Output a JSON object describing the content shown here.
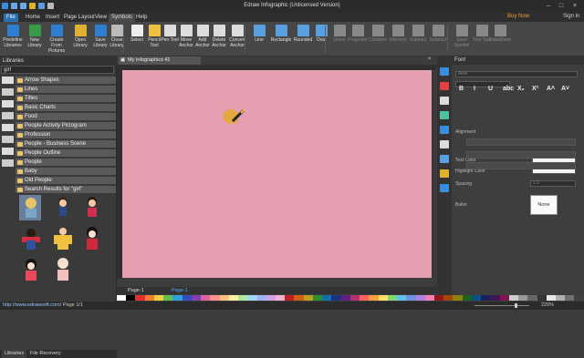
{
  "app": {
    "title": "Edraw Infographic (Unlicensed Version)",
    "buy_now": "Buy Now",
    "sign_in": "Sign in"
  },
  "menu": [
    "File",
    "Home",
    "Insert",
    "Page Layout",
    "View",
    "Symbols",
    "Help"
  ],
  "ribbon": [
    {
      "label": "Predefine Libraries",
      "icon": "library-icon",
      "color": "#2f7fd0"
    },
    {
      "label": "New Library",
      "icon": "new-library-icon",
      "color": "#3a9a4a"
    },
    {
      "label": "Create From Pictures",
      "icon": "picture-icon",
      "color": "#2f7fd0"
    },
    {
      "label": "Open Library",
      "icon": "folder-icon",
      "color": "#e0b030"
    },
    {
      "label": "Save Library",
      "icon": "save-icon",
      "color": "#2f7fd0"
    },
    {
      "label": "Close Library",
      "icon": "close-library-icon",
      "color": "#bbbbbb"
    },
    {
      "label": "Select",
      "icon": "cursor-icon",
      "color": "#eeeeee"
    },
    {
      "label": "Pencil Tool",
      "icon": "pencil-icon",
      "color": "#f0c040"
    },
    {
      "label": "Pen Tool",
      "icon": "pen-icon",
      "color": "#dddddd"
    },
    {
      "label": "Move Anchor",
      "icon": "move-anchor-icon",
      "color": "#dddddd"
    },
    {
      "label": "Add Anchor",
      "icon": "add-anchor-icon",
      "color": "#dddddd"
    },
    {
      "label": "Delete Anchor",
      "icon": "delete-anchor-icon",
      "color": "#dddddd"
    },
    {
      "label": "Convert Anchor",
      "icon": "convert-anchor-icon",
      "color": "#dddddd"
    },
    {
      "label": "Line",
      "icon": "line-icon",
      "color": "#5aa0e0"
    },
    {
      "label": "Rectangle",
      "icon": "rectangle-icon",
      "color": "#5aa0e0"
    },
    {
      "label": "Rounded",
      "icon": "rounded-rect-icon",
      "color": "#5aa0e0"
    },
    {
      "label": "Oval",
      "icon": "oval-icon",
      "color": "#5aa0e0"
    },
    {
      "label": "Union",
      "icon": "union-icon",
      "color": "#888888"
    },
    {
      "label": "Fragment",
      "icon": "fragment-icon",
      "color": "#888888"
    },
    {
      "label": "Combine",
      "icon": "combine-icon",
      "color": "#888888"
    },
    {
      "label": "Intersect",
      "icon": "intersect-icon",
      "color": "#888888"
    },
    {
      "label": "Subtract",
      "icon": "subtract-icon",
      "color": "#888888"
    },
    {
      "label": "Subtract",
      "icon": "subtract-icon",
      "color": "#888888"
    },
    {
      "label": "Save Symbol",
      "icon": "save-symbol-icon",
      "color": "#888888"
    },
    {
      "label": "Text Tool",
      "icon": "text-tool-icon",
      "color": "#888888"
    },
    {
      "label": "DataSheet",
      "icon": "datasheet-icon",
      "color": "#888888"
    }
  ],
  "libraries": {
    "header": "Libraries",
    "search_value": "girl",
    "items": [
      "Arrow Shapes",
      "Lines",
      "Titles",
      "Basic Charts",
      "Food",
      "People Activity Pictogram",
      "Profession",
      "People - Business Scene",
      "People Outline",
      "People",
      "Baby",
      "Old People",
      "Search Results for \"girl\""
    ],
    "tabs": [
      "Libraries",
      "File Recovery"
    ]
  },
  "document": {
    "tab_label": "My Infographics 41",
    "page_label": "Page-1",
    "page_label_active": "Page-1",
    "canvas_color": "#e49fb0"
  },
  "status": {
    "url": "http://www.edrawsoft.com/",
    "page_info": "Page 1/1",
    "zoom": "220%"
  },
  "font_panel": {
    "header": "Font",
    "font_name": "Arial",
    "format_buttons": [
      "B",
      "I",
      "U",
      "abc",
      "X₂",
      "X²",
      "A˄",
      "A˅"
    ],
    "text_color_label": "Text Color",
    "highlight_label": "Highlight Color",
    "alignment_label": "Alignment",
    "spacing_label": "Spacing",
    "spacing_value": "1.0",
    "bullet_label": "Bullet",
    "bullet_value": "None"
  },
  "palette": [
    "#ffffff",
    "#000000",
    "#e03030",
    "#f08030",
    "#f0d040",
    "#60c050",
    "#30a0e0",
    "#3050c0",
    "#8040b0",
    "#e060a0",
    "#ff9090",
    "#ffc080",
    "#fff0a0",
    "#b0e8a0",
    "#a0d8f8",
    "#a0b0f0",
    "#d0a0e8",
    "#f8b0d0",
    "#c02020",
    "#d06010",
    "#c0a020",
    "#309030",
    "#1070b0",
    "#203080",
    "#602080",
    "#b03070",
    "#ff6060",
    "#ffa040",
    "#ffe060",
    "#80d870",
    "#60c0f0",
    "#7090e0",
    "#b080e0",
    "#f080b8",
    "#901818",
    "#a04808",
    "#908010",
    "#206020",
    "#085080",
    "#182060",
    "#401858",
    "#801850",
    "#cccccc",
    "#999999",
    "#666666",
    "#333333",
    "#e8e8e8",
    "#b0b0b0",
    "#707070",
    "#404040"
  ]
}
